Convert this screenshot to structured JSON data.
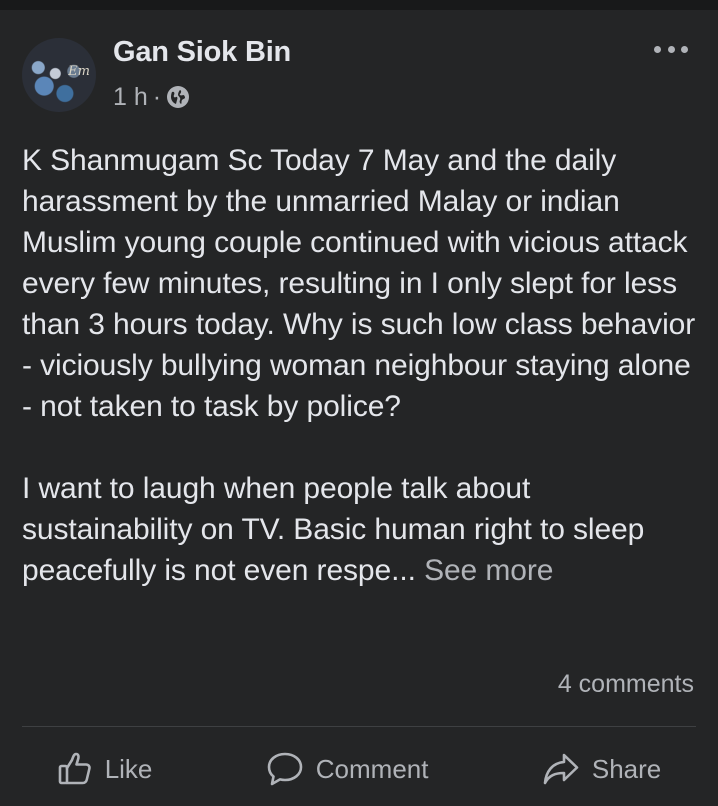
{
  "post": {
    "author": "Gan Siok Bin",
    "timestamp": "1 h",
    "separator": "·",
    "privacy_icon": "globe-icon",
    "avatar_script": "Em",
    "paragraphs": [
      "K Shanmugam Sc Today 7 May and the daily harassment by the unmarried Malay or indian Muslim young couple continued with vicious attack every few minutes, resulting in I only slept for less than 3 hours today. Why is such low class behavior - viciously bullying woman neighbour staying alone - not taken to task by police?",
      "I want to laugh when people talk about sustainability on TV. Basic human right to sleep peacefully is not even respe..."
    ],
    "see_more": "See more",
    "comments_count": "4 comments"
  },
  "actions": {
    "like": {
      "label": "Like",
      "icon": "thumbs-up-icon"
    },
    "comment": {
      "label": "Comment",
      "icon": "speech-bubble-icon"
    },
    "share": {
      "label": "Share",
      "icon": "share-arrow-icon"
    }
  },
  "colors": {
    "background": "#242526",
    "primary_text": "#e4e6eb",
    "secondary_text": "#b0b3b8",
    "divider": "#3e4042"
  }
}
